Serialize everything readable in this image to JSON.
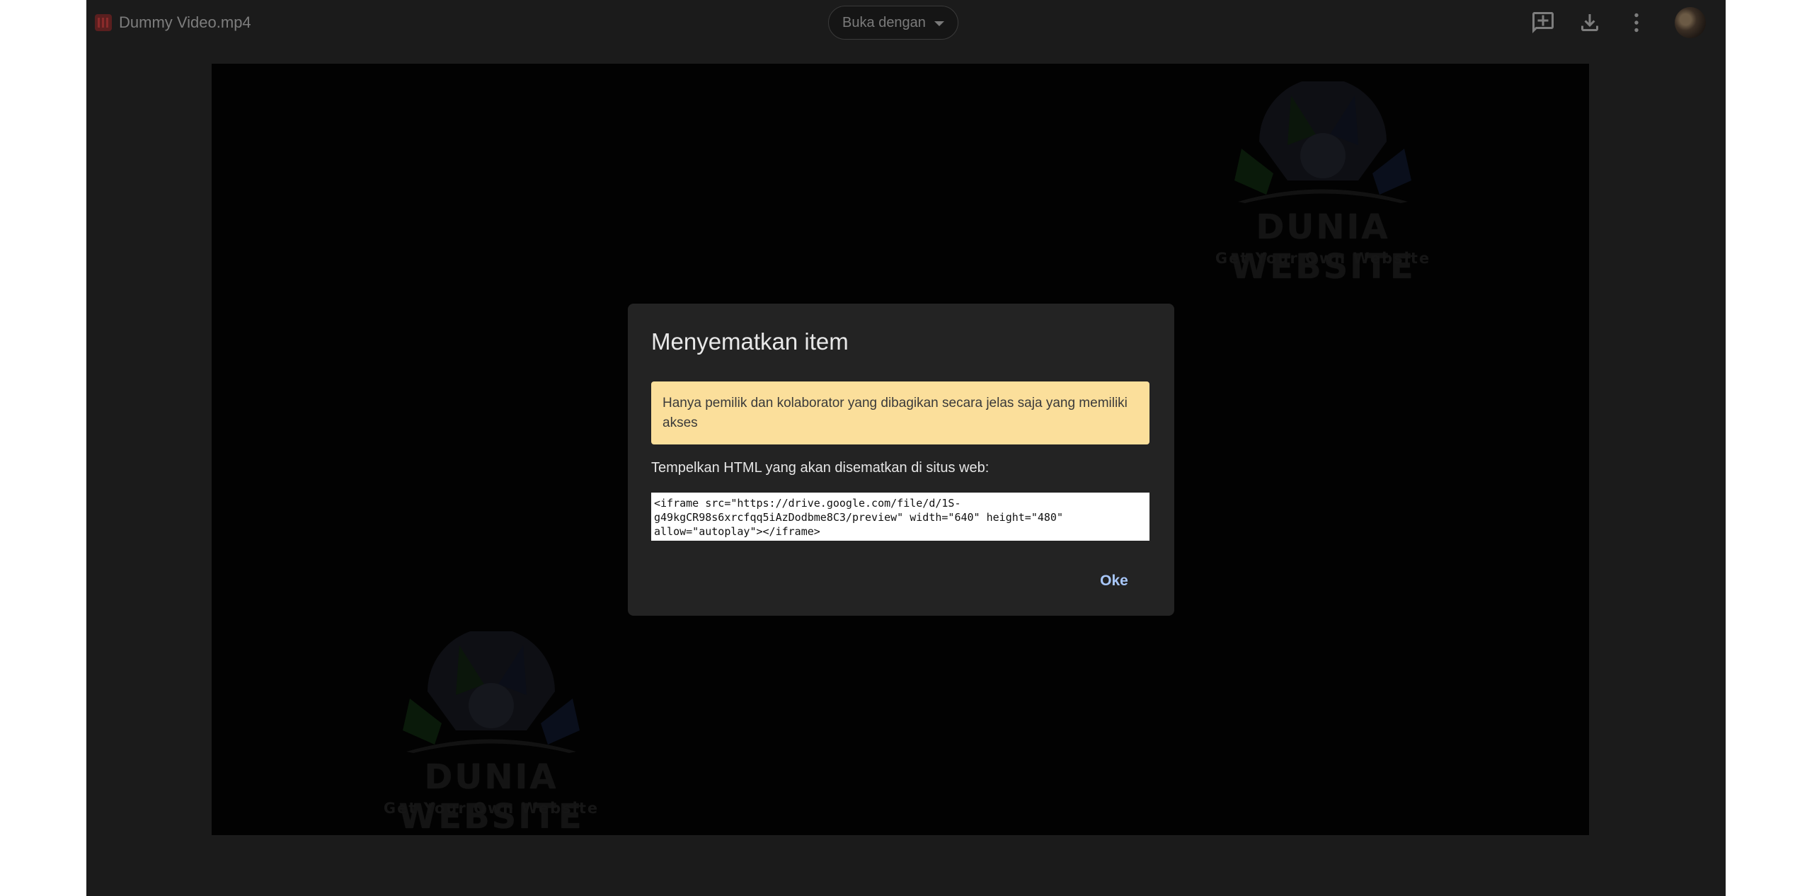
{
  "viewer": {
    "file_icon": "video-file-icon",
    "file_name": "Dummy Video.mp4",
    "open_with_label": "Buka dengan",
    "icons": [
      "add-comment-icon",
      "download-icon",
      "more-vert-icon"
    ],
    "avatar": "account-avatar"
  },
  "watermark": {
    "title": "DUNIA WEBSITE",
    "subtitle": "Get Your Own Website"
  },
  "dialog": {
    "title": "Menyematkan item",
    "warning": "Hanya pemilik dan kolaborator yang dibagikan secara jelas saja yang memiliki akses",
    "embed_label": "Tempelkan HTML yang akan disematkan di situs web:",
    "embed_code": "<iframe src=\"https://drive.google.com/file/d/1S-\ng49kgCR98s6xrcfqq5iAzDodbme8C3/preview\" width=\"640\" height=\"480\"\nallow=\"autoplay\"></iframe>",
    "ok_label": "Oke"
  },
  "colors": {
    "dialog_bg": "#232323",
    "warning_bg": "#fbdf9b",
    "ok_text": "#a8c7fa"
  }
}
